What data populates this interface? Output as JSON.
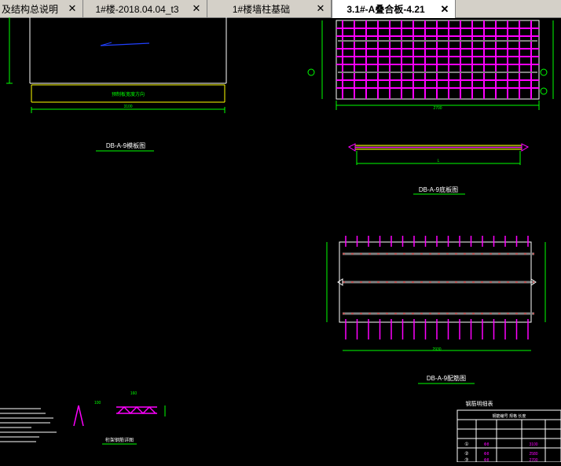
{
  "tabs": [
    {
      "label": "及结构总说明"
    },
    {
      "label": "1#楼-2018.04.04_t3"
    },
    {
      "label": "1#楼墙柱基础"
    },
    {
      "label": "3.1#-A叠合板-4.21"
    }
  ],
  "close_glyph": "✕",
  "drawing": {
    "plan_label": "DB-A-9模板图",
    "section_label": "DB-A-9底板图",
    "rebar_label": "DB-A-9配筋图",
    "truss_label": "桁架钢筋详图",
    "plan_note": "预制板宽度方向",
    "table_title": "钢筋明细表",
    "dim_left": "3100",
    "dim_top_bottom": "2700",
    "dim_rebar_bottom": "2930",
    "dim_side_short": "L",
    "dim_small_a": "160",
    "dim_small_b": "100",
    "table_header_text": "钢筋编号 规格 长度",
    "table_rows": [
      {
        "id": "①",
        "spec": "Φ8",
        "len": "3100"
      },
      {
        "id": "②",
        "spec": "Φ8",
        "len": "2580"
      },
      {
        "id": "③",
        "spec": "Φ8",
        "len": "2700"
      }
    ]
  },
  "colors": {
    "magenta": "#ff00ff",
    "green": "#00ff00",
    "yellow": "#ffff00",
    "white": "#ffffff",
    "cyan": "#00ffff",
    "red": "#ff3030",
    "blue": "#2040ff",
    "gray": "#808080"
  }
}
